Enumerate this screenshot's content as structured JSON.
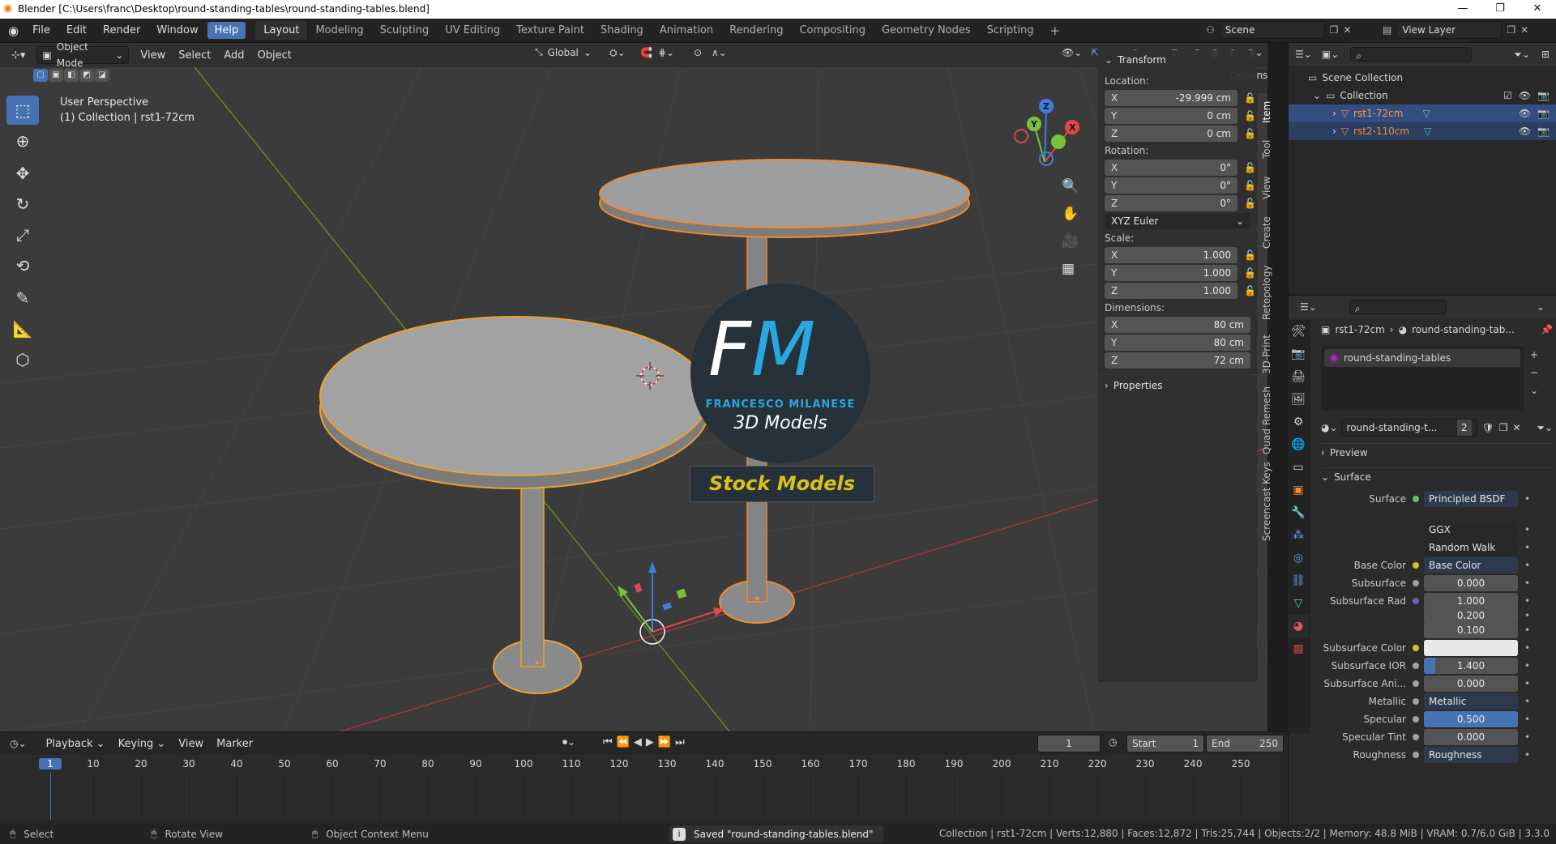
{
  "window": {
    "title": "Blender [C:\\Users\\franc\\Desktop\\round-standing-tables\\round-standing-tables.blend]"
  },
  "menu": [
    "File",
    "Edit",
    "Render",
    "Window",
    "Help"
  ],
  "workspaces": [
    "Layout",
    "Modeling",
    "Sculpting",
    "UV Editing",
    "Texture Paint",
    "Shading",
    "Animation",
    "Rendering",
    "Compositing",
    "Geometry Nodes",
    "Scripting"
  ],
  "scene": {
    "name": "Scene",
    "view_layer": "View Layer"
  },
  "viewport": {
    "mode": "Object Mode",
    "menus": [
      "View",
      "Select",
      "Add",
      "Object"
    ],
    "orientation": "Global",
    "options": "Options",
    "perspective": "User Perspective",
    "collection_info": "(1) Collection | rst1-72cm"
  },
  "logo": {
    "letters": "FM",
    "name": "FRANCESCO MILANESE",
    "sub": "3D Models",
    "banner": "Stock Models"
  },
  "npanel": {
    "header": "Transform",
    "location_label": "Location:",
    "location": [
      {
        "axis": "X",
        "value": "-29.999 cm"
      },
      {
        "axis": "Y",
        "value": "0 cm"
      },
      {
        "axis": "Z",
        "value": "0 cm"
      }
    ],
    "rotation_label": "Rotation:",
    "rotation": [
      {
        "axis": "X",
        "value": "0°"
      },
      {
        "axis": "Y",
        "value": "0°"
      },
      {
        "axis": "Z",
        "value": "0°"
      }
    ],
    "rotation_mode": "XYZ Euler",
    "scale_label": "Scale:",
    "scale": [
      {
        "axis": "X",
        "value": "1.000"
      },
      {
        "axis": "Y",
        "value": "1.000"
      },
      {
        "axis": "Z",
        "value": "1.000"
      }
    ],
    "dimensions_label": "Dimensions:",
    "dimensions": [
      {
        "axis": "X",
        "value": "80 cm"
      },
      {
        "axis": "Y",
        "value": "80 cm"
      },
      {
        "axis": "Z",
        "value": "72 cm"
      }
    ],
    "properties": "Properties",
    "tabs": [
      "Item",
      "Tool",
      "View",
      "Create",
      "Retopology",
      "3D-Print",
      "Quad Remesh",
      "Screencast Keys"
    ]
  },
  "outliner": {
    "scene_collection": "Scene Collection",
    "collection": "Collection",
    "objects": [
      "rst1-72cm",
      "rst2-110cm"
    ]
  },
  "props": {
    "breadcrumb_obj": "rst1-72cm",
    "breadcrumb_mat": "round-standing-tab...",
    "material_slot": "round-standing-tables",
    "material_name": "round-standing-t...",
    "users": "2",
    "preview": "Preview",
    "surface_section": "Surface",
    "rows": [
      {
        "label": "Surface",
        "value": "Principled BSDF",
        "dot": "#5ec35e",
        "style": "link"
      },
      {
        "label": "",
        "value": "GGX",
        "dot": "",
        "style": "select"
      },
      {
        "label": "",
        "value": "Random Walk",
        "dot": "",
        "style": "select"
      },
      {
        "label": "Base Color",
        "value": "Base Color",
        "dot": "#c7c729",
        "style": "link"
      },
      {
        "label": "Subsurface",
        "value": "0.000",
        "dot": "#a1a1a1",
        "style": "num"
      },
      {
        "label": "Subsurface Rad",
        "value": "1.000",
        "dot": "#6363c7",
        "style": "num"
      },
      {
        "label": "",
        "value": "0.200",
        "dot": "",
        "style": "num"
      },
      {
        "label": "",
        "value": "0.100",
        "dot": "",
        "style": "num"
      },
      {
        "label": "Subsurface Color",
        "value": "",
        "dot": "#c7c729",
        "style": "white"
      },
      {
        "label": "Subsurface IOR",
        "value": "1.400",
        "dot": "#a1a1a1",
        "style": "partial"
      },
      {
        "label": "Subsurface Ani...",
        "value": "0.000",
        "dot": "#a1a1a1",
        "style": "num"
      },
      {
        "label": "Metallic",
        "value": "Metallic",
        "dot": "#a1a1a1",
        "style": "link"
      },
      {
        "label": "Specular",
        "value": "0.500",
        "dot": "#a1a1a1",
        "style": "blue"
      },
      {
        "label": "Specular Tint",
        "value": "0.000",
        "dot": "#a1a1a1",
        "style": "num"
      },
      {
        "label": "Roughness",
        "value": "Roughness",
        "dot": "#a1a1a1",
        "style": "link"
      }
    ]
  },
  "timeline": {
    "menus": [
      "Playback",
      "Keying",
      "View",
      "Marker"
    ],
    "current_frame": "1",
    "start_label": "Start",
    "start": "1",
    "end_label": "End",
    "end": "250",
    "ticks": [
      "1",
      "10",
      "20",
      "30",
      "40",
      "50",
      "60",
      "70",
      "80",
      "90",
      "100",
      "110",
      "120",
      "130",
      "140",
      "150",
      "160",
      "170",
      "180",
      "190",
      "200",
      "210",
      "220",
      "230",
      "240",
      "250"
    ]
  },
  "status": {
    "select": "Select",
    "rotate": "Rotate View",
    "context": "Object Context Menu",
    "saved": "Saved \"round-standing-tables.blend\"",
    "stats": "Collection | rst1-72cm | Verts:12,880 | Faces:12,872 | Tris:25,744 | Objects:2/2 | Memory: 48.8 MiB | VRAM: 0.7/6.0 GiB | 3.3.0"
  }
}
